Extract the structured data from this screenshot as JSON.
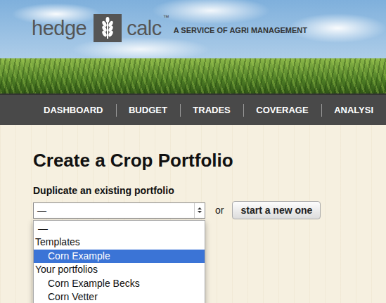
{
  "brand": {
    "name_left": "hedge",
    "name_right": "calc",
    "trademark": "™",
    "tagline": "A SERVICE OF AGRI MANAGEMENT"
  },
  "nav": [
    {
      "label": "DASHBOARD",
      "selected": false
    },
    {
      "label": "BUDGET",
      "selected": false
    },
    {
      "label": "TRADES",
      "selected": false
    },
    {
      "label": "COVERAGE",
      "selected": false
    },
    {
      "label": "ANALYSI",
      "selected": false
    }
  ],
  "page": {
    "title": "Create a Crop Portfolio"
  },
  "duplicate": {
    "label": "Duplicate an existing portfolio",
    "value": "—",
    "separator": "or",
    "new_button": "start a new one"
  },
  "dropdown": {
    "open": true,
    "options": [
      {
        "kind": "option",
        "label": "—",
        "selected": false
      },
      {
        "kind": "group",
        "label": "Templates",
        "selected": false
      },
      {
        "kind": "option",
        "label": "Corn Example",
        "selected": true
      },
      {
        "kind": "group",
        "label": "Your portfolios",
        "selected": false
      },
      {
        "kind": "option",
        "label": "Corn Example Becks",
        "selected": false
      },
      {
        "kind": "option",
        "label": "Corn Vetter",
        "selected": false
      }
    ]
  }
}
